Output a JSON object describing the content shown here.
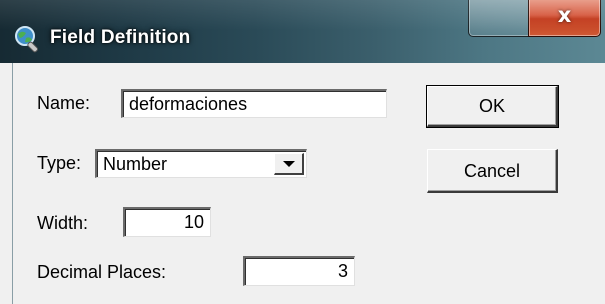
{
  "window": {
    "title": "Field Definition",
    "app_icon": "magnifier-globe-icon",
    "title_bar_colors": [
      "#162a33",
      "#5c8894"
    ],
    "close_button_color": "#c23a1c",
    "close_glyph": "x"
  },
  "form": {
    "name_label": "Name:",
    "name_value": "deformaciones",
    "type_label": "Type:",
    "type_value": "Number",
    "width_label": "Width:",
    "width_value": "10",
    "decimal_label": "Decimal Places:",
    "decimal_value": "3"
  },
  "buttons": {
    "ok_label": "OK",
    "cancel_label": "Cancel"
  }
}
